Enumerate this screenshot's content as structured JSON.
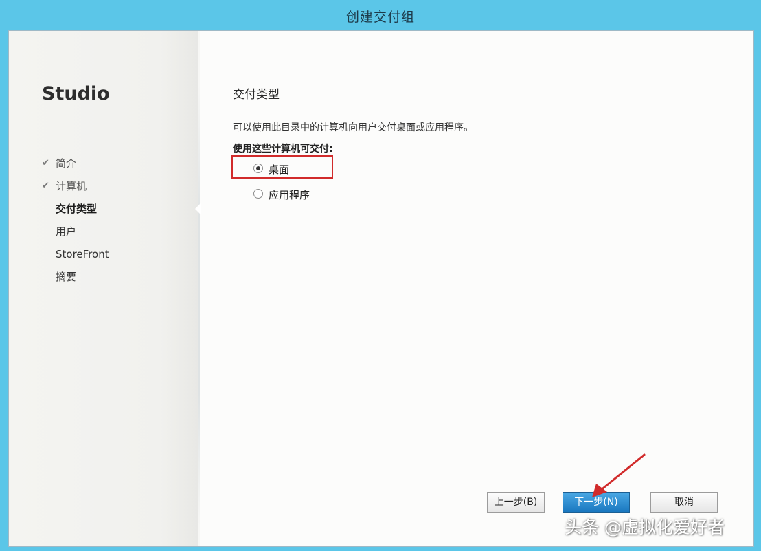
{
  "window": {
    "title": "创建交付组"
  },
  "sidebar": {
    "brand": "Studio",
    "steps": [
      {
        "label": "简介",
        "state": "done"
      },
      {
        "label": "计算机",
        "state": "done"
      },
      {
        "label": "交付类型",
        "state": "current"
      },
      {
        "label": "用户",
        "state": "pending"
      },
      {
        "label": "StoreFront",
        "state": "pending"
      },
      {
        "label": "摘要",
        "state": "pending"
      }
    ]
  },
  "main": {
    "section_title": "交付类型",
    "description": "可以使用此目录中的计算机向用户交付桌面或应用程序。",
    "question": "使用这些计算机可交付:",
    "options": [
      {
        "label": "桌面",
        "selected": true
      },
      {
        "label": "应用程序",
        "selected": false
      }
    ]
  },
  "footer": {
    "back_label": "上一步(B)",
    "next_label": "下一步(N)",
    "cancel_label": "取消"
  },
  "watermark": "头条 @虚拟化爱好者",
  "colors": {
    "titlebar": "#5bc6e8",
    "highlight_box": "#d12b2b",
    "primary_button": "#1a78c0",
    "annotation_arrow": "#d12b2b"
  }
}
